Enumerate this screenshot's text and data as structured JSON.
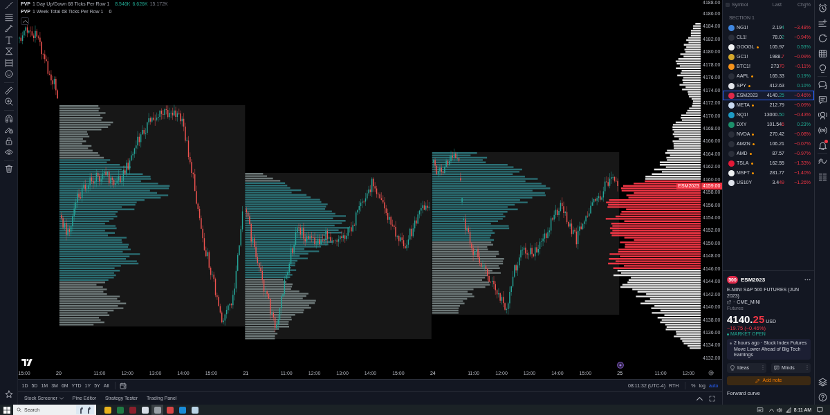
{
  "chart": {
    "legend": [
      {
        "name": "PVP",
        "title": "1 Day Up/Down 68 Ticks Per Row 1",
        "values": [
          {
            "text": "8.546K",
            "kind": "up"
          },
          {
            "text": "6.626K",
            "kind": "up"
          },
          {
            "text": "15.172K",
            "kind": "muted"
          }
        ]
      },
      {
        "name": "PVP",
        "title": "1 Week Total 68 Ticks Per Row 1",
        "values": [
          {
            "text": "0",
            "kind": "plain"
          }
        ]
      }
    ],
    "symbol_tag": "ESM2023",
    "price_tag": "4159.00",
    "price_axis": [
      "4188.00",
      "4186.00",
      "4184.00",
      "4182.00",
      "4180.00",
      "4178.00",
      "4176.00",
      "4174.00",
      "4172.00",
      "4170.00",
      "4168.00",
      "4166.00",
      "4164.00",
      "4162.00",
      "4160.00",
      "4158.00",
      "4156.00",
      "4154.00",
      "4152.00",
      "4150.00",
      "4148.00",
      "4146.00",
      "4144.00",
      "4142.00",
      "4140.00",
      "4138.00",
      "4136.00",
      "4134.00",
      "4132.00"
    ],
    "time_axis": [
      {
        "label": "15:00",
        "kind": "time"
      },
      {
        "label": "20",
        "kind": "day"
      },
      {
        "label": "11:00",
        "kind": "time"
      },
      {
        "label": "12:00",
        "kind": "time"
      },
      {
        "label": "13:00",
        "kind": "time"
      },
      {
        "label": "14:00",
        "kind": "time"
      },
      {
        "label": "15:00",
        "kind": "time"
      },
      {
        "label": "21",
        "kind": "day"
      },
      {
        "label": "11:00",
        "kind": "time"
      },
      {
        "label": "12:00",
        "kind": "time"
      },
      {
        "label": "13:00",
        "kind": "time"
      },
      {
        "label": "14:00",
        "kind": "time"
      },
      {
        "label": "15:00",
        "kind": "time"
      },
      {
        "label": "24",
        "kind": "day"
      },
      {
        "label": "11:00",
        "kind": "time"
      },
      {
        "label": "12:00",
        "kind": "time"
      },
      {
        "label": "13:00",
        "kind": "time"
      },
      {
        "label": "14:00",
        "kind": "time"
      },
      {
        "label": "15:00",
        "kind": "time"
      },
      {
        "label": "25",
        "kind": "day"
      },
      {
        "label": "11:00",
        "kind": "time"
      },
      {
        "label": "12:00",
        "kind": "time"
      }
    ]
  },
  "range_bar": {
    "ranges": [
      {
        "label": "1D",
        "selected": false
      },
      {
        "label": "5D",
        "selected": false
      },
      {
        "label": "1M",
        "selected": false
      },
      {
        "label": "3M",
        "selected": false
      },
      {
        "label": "6M",
        "selected": false
      },
      {
        "label": "YTD",
        "selected": false
      },
      {
        "label": "1Y",
        "selected": false
      },
      {
        "label": "5Y",
        "selected": false
      },
      {
        "label": "All",
        "selected": false
      }
    ],
    "clock": "08:11:32 (UTC-4)",
    "session": "RTH",
    "toggles": [
      {
        "label": "%",
        "on": false
      },
      {
        "label": "log",
        "on": false
      },
      {
        "label": "auto",
        "on": true
      }
    ]
  },
  "bottom_tabs": [
    {
      "label": "Stock Screener",
      "dropdown": true,
      "selected": false
    },
    {
      "label": "Pine Editor",
      "dropdown": false,
      "selected": false
    },
    {
      "label": "Strategy Tester",
      "dropdown": false,
      "selected": false
    },
    {
      "label": "Trading Panel",
      "dropdown": false,
      "selected": false
    }
  ],
  "watchlist": {
    "columns": [
      "Symbol",
      "Last",
      "Chg%"
    ],
    "section": "SECTION 1",
    "rows": [
      {
        "symbol": "NG1!",
        "color": "#3f86e0",
        "dot": false,
        "last": "2.19",
        "last_changed": "4",
        "tick_up": true,
        "change": "−3.48%",
        "positive": false,
        "selected": false
      },
      {
        "symbol": "CL1!",
        "color": "#2a2e39",
        "dot": false,
        "last": "78.0",
        "last_changed": "2",
        "tick_up": true,
        "change": "−0.94%",
        "positive": false,
        "selected": false
      },
      {
        "symbol": "GOOGL",
        "color": "#f1f3f4",
        "dot": true,
        "last": "105.97",
        "change": "0.53%",
        "positive": true,
        "selected": false
      },
      {
        "symbol": "GC1!",
        "color": "#d4a72c",
        "dot": false,
        "last": "1988.",
        "last_changed": "7",
        "tick_up": false,
        "change": "−0.09%",
        "positive": false,
        "selected": false
      },
      {
        "symbol": "BTC1!",
        "color": "#f7931a",
        "dot": false,
        "last": "273",
        "last_changed": "70",
        "tick_up": false,
        "change": "−0.11%",
        "positive": false,
        "selected": false
      },
      {
        "symbol": "AAPL",
        "color": "#2a2e39",
        "dot": true,
        "last": "165.33",
        "change": "0.19%",
        "positive": true,
        "selected": false
      },
      {
        "symbol": "SPY",
        "color": "#e3e5ea",
        "dot": true,
        "last": "412.63",
        "change": "0.10%",
        "positive": true,
        "selected": false
      },
      {
        "symbol": "ESM2023",
        "color": "#e0294a",
        "dot": false,
        "last": "4140.",
        "last_changed": "25",
        "tick_up": true,
        "change": "−0.46%",
        "positive": false,
        "selected": true
      },
      {
        "symbol": "META",
        "color": "#c9daf0",
        "dot": true,
        "last": "212.79",
        "change": "−0.09%",
        "positive": false,
        "selected": false
      },
      {
        "symbol": "NQ1!",
        "color": "#1e9bc4",
        "dot": false,
        "last": "13000.",
        "last_changed": "50",
        "tick_up": true,
        "change": "−0.43%",
        "positive": false,
        "selected": false
      },
      {
        "symbol": "DXY",
        "color": "#1c8f6a",
        "dot": false,
        "last": "101.54",
        "last_changed": "6",
        "tick_up": false,
        "change": "0.23%",
        "positive": true,
        "selected": false
      },
      {
        "symbol": "NVDA",
        "color": "#2a2e39",
        "dot": true,
        "last": "270.42",
        "change": "−0.08%",
        "positive": false,
        "selected": false
      },
      {
        "symbol": "AMZN",
        "color": "#2a2e39",
        "dot": true,
        "last": "106.21",
        "change": "−0.07%",
        "positive": false,
        "selected": false
      },
      {
        "symbol": "AMD",
        "color": "#2a2e39",
        "dot": true,
        "last": "87.57",
        "change": "−0.97%",
        "positive": false,
        "selected": false
      },
      {
        "symbol": "TSLA",
        "color": "#e31937",
        "dot": true,
        "last": "162.55",
        "change": "−1.33%",
        "positive": false,
        "selected": false
      },
      {
        "symbol": "MSFT",
        "color": "#eef0f2",
        "dot": true,
        "last": "281.77",
        "change": "−1.40%",
        "positive": false,
        "selected": false
      },
      {
        "symbol": "US10Y",
        "color": "#dfe3ec",
        "dot": false,
        "last": "3.4",
        "last_changed": "49",
        "tick_up": false,
        "change": "−1.26%",
        "positive": false,
        "selected": false
      }
    ]
  },
  "details": {
    "logo": "500",
    "symbol": "ESM2023",
    "name": "E-MINI S&P 500 FUTURES (JUN 2023)",
    "separator": "·",
    "exchange": "CME_MINI",
    "type": "Futures",
    "price": "4140.",
    "price_tail": "25",
    "currency": "USD",
    "positive": false,
    "change": "−19.75 (−0.46%)",
    "market_open": true,
    "status": "MARKET OPEN",
    "news": "2 hours ago · Stock Index Futures Move Lower Ahead of Big Tech Earnings",
    "buttons": [
      {
        "label": "Ideas",
        "kind": "ideas"
      },
      {
        "label": "Minds",
        "kind": "minds"
      }
    ],
    "add_note": "Add note",
    "section": "Forward curve"
  },
  "taskbar": {
    "search_placeholder": "Search",
    "apps": [
      {
        "color": "#e8b21c",
        "selected": false
      },
      {
        "color": "#1f7a44",
        "selected": false
      },
      {
        "color": "#8a1f2c",
        "selected": false
      },
      {
        "color": "#d8dde6",
        "selected": false
      },
      {
        "color": "#9aa0a6",
        "selected": true
      },
      {
        "color": "#d64545",
        "selected": false
      },
      {
        "color": "#1a8cd8",
        "selected": false
      },
      {
        "color": "#b9d3e6",
        "selected": false
      }
    ],
    "clock": "8:11 AM"
  }
}
